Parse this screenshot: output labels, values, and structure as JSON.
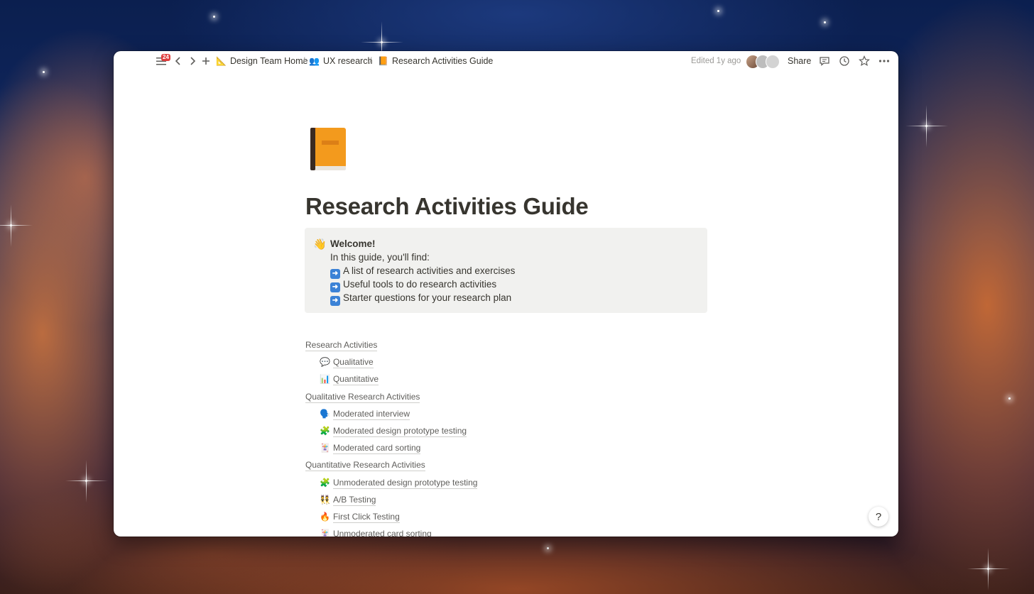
{
  "topbar": {
    "notification_count": "24",
    "breadcrumbs": [
      {
        "emoji": "📐",
        "label": "Design Team Home"
      },
      {
        "emoji": "👥",
        "label": "UX research"
      },
      {
        "emoji": "📙",
        "label": "Research Activities Guide"
      }
    ],
    "separator": "/",
    "edited": "Edited 1y ago",
    "share_label": "Share"
  },
  "page": {
    "title": "Research Activities Guide",
    "callout": {
      "emoji": "👋",
      "heading": "Welcome!",
      "intro": "In this guide, you'll find:",
      "items": [
        "A list of research activities and exercises",
        "Useful tools to do research activities",
        "Starter questions for your research plan"
      ]
    },
    "toc": [
      {
        "label": "Research Activities",
        "emoji": ""
      },
      {
        "label": "Qualitative",
        "emoji": "💬"
      },
      {
        "label": "Quantitative",
        "emoji": "📊"
      },
      {
        "label": "Qualitative Research Activities",
        "emoji": ""
      },
      {
        "label": "Moderated interview",
        "emoji": "🗣️"
      },
      {
        "label": "Moderated design prototype testing",
        "emoji": "🧩"
      },
      {
        "label": "Moderated card sorting",
        "emoji": "🃏"
      },
      {
        "label": "Quantitative Research Activities",
        "emoji": ""
      },
      {
        "label": "Unmoderated design prototype testing",
        "emoji": "🧩"
      },
      {
        "label": "A/B Testing",
        "emoji": "👯"
      },
      {
        "label": "First Click Testing",
        "emoji": "🔥"
      },
      {
        "label": "Unmoderated card sorting",
        "emoji": "🃏"
      }
    ]
  },
  "help_label": "?"
}
